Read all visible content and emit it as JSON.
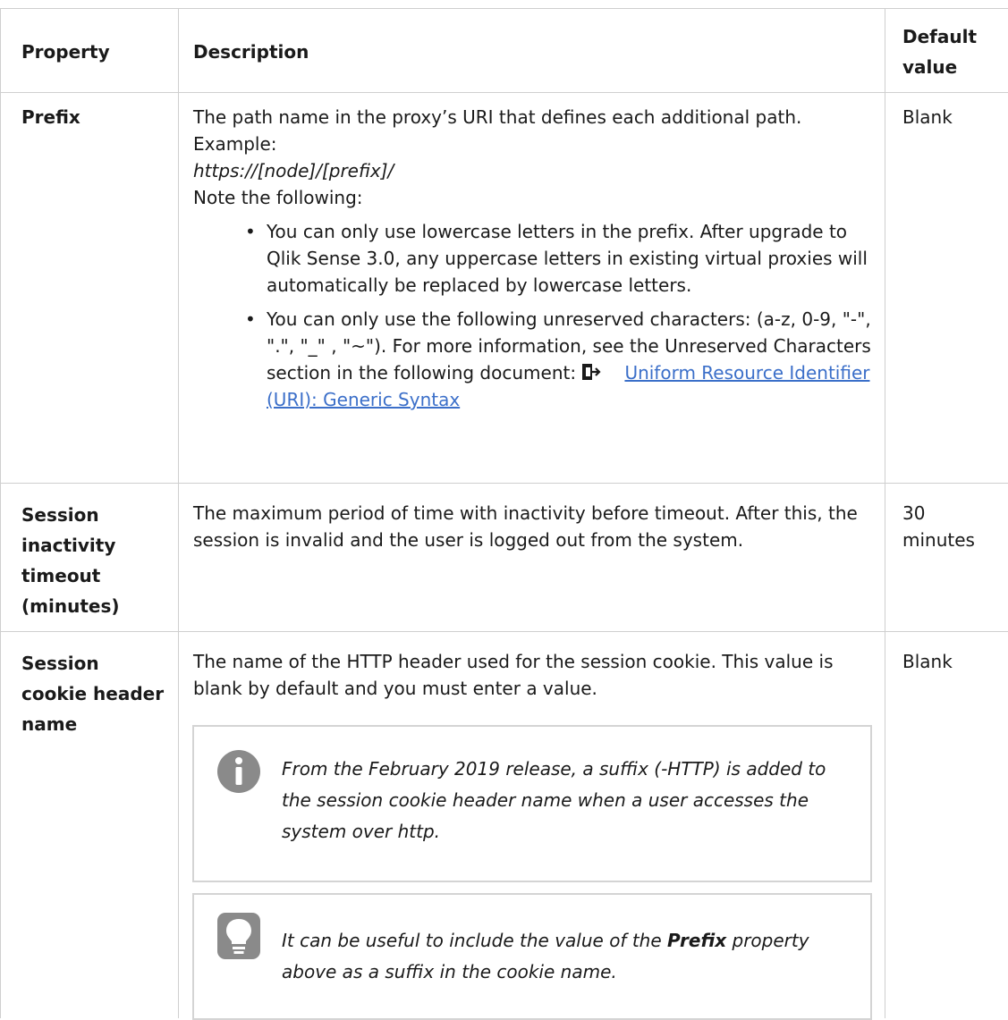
{
  "table": {
    "headers": {
      "property": "Property",
      "description": "Description",
      "default": "Default value"
    },
    "rows": {
      "prefix": {
        "property": "Prefix",
        "default": "Blank",
        "desc_line1": "The path name in the proxy’s URI that defines each additional path.",
        "desc_example": "Example:",
        "desc_url": "https://[node]/[prefix]/",
        "desc_note": "Note the following:",
        "bullet1": "You can only use lowercase letters in the prefix. After upgrade to Qlik Sense 3.0, any uppercase letters in existing virtual proxies will automatically be replaced by lowercase letters.",
        "bullet2_text": "You can only use the following unreserved characters: (a-z, 0-9, \"-\", \".\", \"_\" , \"~\"). For more information, see the Unreserved Characters section in the following document:",
        "bullet2_link": "Uniform Resource Identifier (URI): Generic Syntax",
        "link_icon": "external-link-icon"
      },
      "session_timeout": {
        "property": "Session inactivity timeout (minutes)",
        "default": "30 minutes",
        "description": "The maximum period of time with inactivity before timeout. After this, the session is invalid and the user is logged out from the system."
      },
      "cookie_header": {
        "property": "Session cookie header name",
        "default": "Blank",
        "description": "The name of the HTTP header used for the session cookie. This value is blank by default and you must enter a value.",
        "info_note": {
          "icon": "info-icon",
          "text": "From the February 2019 release, a suffix (-HTTP) is added to the session cookie header name when a user accesses the system over http."
        },
        "tip_note": {
          "icon": "lightbulb-icon",
          "text_before": "It can be useful to include the value of the ",
          "text_bold": "Prefix",
          "text_after": " property above as a suffix in the cookie name."
        }
      }
    },
    "colors": {
      "border": "#cfcfcf",
      "link": "#3b6fc9",
      "icon_gray": "#8a8a8a"
    }
  }
}
